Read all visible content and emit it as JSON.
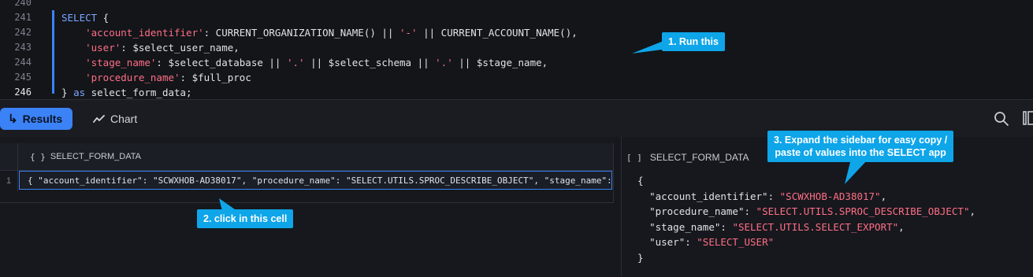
{
  "editor": {
    "line_numbers": [
      "240",
      "241",
      "242",
      "243",
      "244",
      "245",
      "246"
    ],
    "lines": [
      [],
      [
        {
          "t": "SELECT",
          "c": "kw"
        },
        {
          "t": " {",
          "c": ""
        }
      ],
      [
        {
          "t": "    ",
          "c": ""
        },
        {
          "t": "'account_identifier'",
          "c": "str"
        },
        {
          "t": ": CURRENT_ORGANIZATION_NAME() || ",
          "c": ""
        },
        {
          "t": "'-'",
          "c": "str"
        },
        {
          "t": " || CURRENT_ACCOUNT_NAME(),",
          "c": ""
        }
      ],
      [
        {
          "t": "    ",
          "c": ""
        },
        {
          "t": "'user'",
          "c": "str"
        },
        {
          "t": ": $select_user_name,",
          "c": ""
        }
      ],
      [
        {
          "t": "    ",
          "c": ""
        },
        {
          "t": "'stage_name'",
          "c": "str"
        },
        {
          "t": ": $select_database || ",
          "c": ""
        },
        {
          "t": "'.'",
          "c": "str"
        },
        {
          "t": " || $select_schema || ",
          "c": ""
        },
        {
          "t": "'.'",
          "c": "str"
        },
        {
          "t": " || $stage_name,",
          "c": ""
        }
      ],
      [
        {
          "t": "    ",
          "c": ""
        },
        {
          "t": "'procedure_name'",
          "c": "str"
        },
        {
          "t": ": $full_proc",
          "c": ""
        }
      ],
      [
        {
          "t": "} ",
          "c": ""
        },
        {
          "t": "as",
          "c": "kw"
        },
        {
          "t": " select_form_data;",
          "c": ""
        }
      ]
    ]
  },
  "toolbar": {
    "results_label": "Results",
    "chart_label": "Chart"
  },
  "grid": {
    "column_type_icon": "{ }",
    "column_header": "SELECT_FORM_DATA",
    "rows": [
      {
        "num": "1",
        "value": "{  \"account_identifier\": \"SCWXHOB-AD38017\",  \"procedure_name\": \"SELECT.UTILS.SPROC_DESCRIBE_OBJECT\",  \"stage_name\": \"SELECT.UTILS.SELECT_EXPORT\",  \"user\": \"SELECT_USER\"}"
      }
    ]
  },
  "sidebar": {
    "type_icon": "[ ]",
    "title": "SELECT_FORM_DATA",
    "open_brace": "{",
    "close_brace": "}",
    "entries": [
      {
        "key": "\"account_identifier\"",
        "value": "\"SCWXHOB-AD38017\"",
        "sep": ","
      },
      {
        "key": "\"procedure_name\"",
        "value": "\"SELECT.UTILS.SPROC_DESCRIBE_OBJECT\"",
        "sep": ","
      },
      {
        "key": "\"stage_name\"",
        "value": "\"SELECT.UTILS.SELECT_EXPORT\"",
        "sep": ","
      },
      {
        "key": "\"user\"",
        "value": "\"SELECT_USER\"",
        "sep": ""
      }
    ]
  },
  "callouts": {
    "c1": "1. Run this",
    "c2": "2. click in this cell",
    "c3_line1": "3. Expand the sidebar for easy copy /",
    "c3_line2": "paste of values into the SELECT app"
  },
  "icons": {
    "results": "return-arrow-icon",
    "chart": "line-chart-icon",
    "search": "search-icon",
    "columns": "columns-icon"
  },
  "colors": {
    "accent": "#3b82f6",
    "callout": "#0ea5e9",
    "string": "#ff6e86",
    "keyword": "#7aa6ff"
  }
}
